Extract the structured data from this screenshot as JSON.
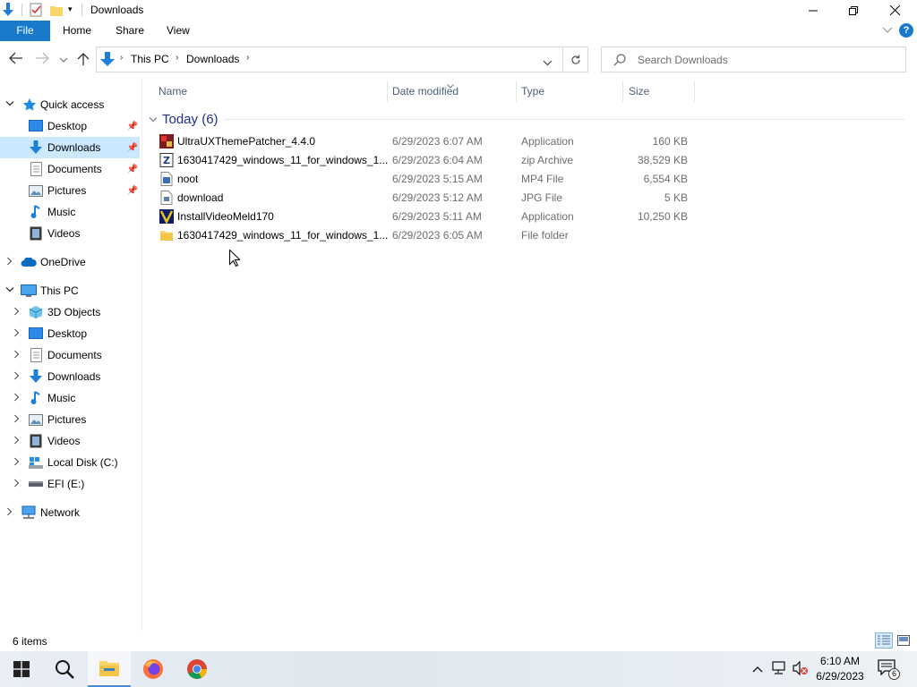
{
  "window": {
    "title": "Downloads"
  },
  "ribbon": {
    "tabs": [
      "File",
      "Home",
      "Share",
      "View"
    ]
  },
  "address": {
    "crumbs": [
      "This PC",
      "Downloads"
    ]
  },
  "search": {
    "placeholder": "Search Downloads"
  },
  "nav": {
    "quick_access": "Quick access",
    "qa_items": [
      "Desktop",
      "Downloads",
      "Documents",
      "Pictures",
      "Music",
      "Videos"
    ],
    "onedrive": "OneDrive",
    "this_pc": "This PC",
    "pc_items": [
      "3D Objects",
      "Desktop",
      "Documents",
      "Downloads",
      "Music",
      "Pictures",
      "Videos",
      "Local Disk (C:)",
      "EFI (E:)"
    ],
    "network": "Network"
  },
  "columns": {
    "name": "Name",
    "date": "Date modified",
    "type": "Type",
    "size": "Size"
  },
  "group": {
    "label": "Today (6)"
  },
  "files": [
    {
      "name": "UltraUXThemePatcher_4.4.0",
      "date": "6/29/2023 6:07 AM",
      "type": "Application",
      "size": "160 KB",
      "icon": "app-icon"
    },
    {
      "name": "1630417429_windows_11_for_windows_1...",
      "date": "6/29/2023 6:04 AM",
      "type": "zip Archive",
      "size": "38,529 KB",
      "icon": "zip-icon"
    },
    {
      "name": "noot",
      "date": "6/29/2023 5:15 AM",
      "type": "MP4 File",
      "size": "6,554 KB",
      "icon": "video-file-icon"
    },
    {
      "name": "download",
      "date": "6/29/2023 5:12 AM",
      "type": "JPG File",
      "size": "5 KB",
      "icon": "image-file-icon"
    },
    {
      "name": "InstallVideoMeld170",
      "date": "6/29/2023 5:11 AM",
      "type": "Application",
      "size": "10,250 KB",
      "icon": "installer-icon"
    },
    {
      "name": "1630417429_windows_11_for_windows_1...",
      "date": "6/29/2023 6:05 AM",
      "type": "File folder",
      "size": "",
      "icon": "folder-icon"
    }
  ],
  "status": {
    "count": "6 items"
  },
  "taskbar": {
    "time": "6:10 AM",
    "date": "6/29/2023",
    "notifications": "6"
  },
  "colors": {
    "accent": "#1979ca",
    "selection": "#cce8ff",
    "group": "#1e3287"
  }
}
